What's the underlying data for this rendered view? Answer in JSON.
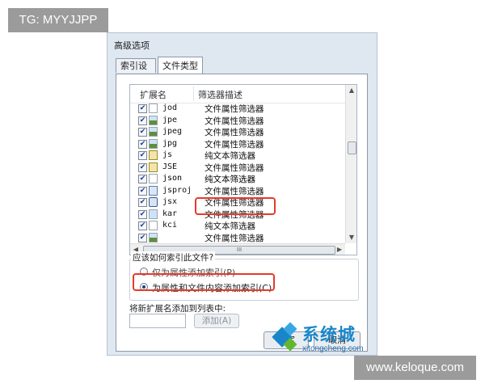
{
  "watermarks": {
    "top_left": "TG: MYYJJPP",
    "bottom_right": "www.keloque.com"
  },
  "dialog": {
    "title": "高级选项",
    "tabs": [
      {
        "label": "索引设置",
        "active": false
      },
      {
        "label": "文件类型",
        "active": true
      }
    ],
    "list": {
      "columns": [
        "扩展名",
        "筛选器描述"
      ],
      "rows": [
        {
          "ext": "jod",
          "filter": "文件属性筛选器",
          "checked": true,
          "icon": "blank-file-icon"
        },
        {
          "ext": "jpe",
          "filter": "文件属性筛选器",
          "checked": true,
          "icon": "image-file-icon"
        },
        {
          "ext": "jpeg",
          "filter": "文件属性筛选器",
          "checked": true,
          "icon": "image-file-icon"
        },
        {
          "ext": "jpg",
          "filter": "文件属性筛选器",
          "checked": true,
          "icon": "image-file-icon"
        },
        {
          "ext": "js",
          "filter": "纯文本筛选器",
          "checked": true,
          "icon": "script-file-icon"
        },
        {
          "ext": "JSE",
          "filter": "文件属性筛选器",
          "checked": true,
          "icon": "script-file-icon"
        },
        {
          "ext": "json",
          "filter": "纯文本筛选器",
          "checked": true,
          "icon": "blank-file-icon",
          "highlighted": true
        },
        {
          "ext": "jsproj",
          "filter": "文件属性筛选器",
          "checked": true,
          "icon": "project-file-icon"
        },
        {
          "ext": "jsx",
          "filter": "文件属性筛选器",
          "checked": true,
          "icon": "jsx-file-icon"
        },
        {
          "ext": "kar",
          "filter": "文件属性筛选器",
          "checked": true,
          "icon": "media-file-icon"
        },
        {
          "ext": "kci",
          "filter": "纯文本筛选器",
          "checked": true,
          "icon": "blank-file-icon"
        },
        {
          "ext": "",
          "filter": "文件属性筛选器",
          "checked": true,
          "icon": "image-file-icon"
        }
      ],
      "hscroll_grip": "III"
    },
    "index_group": {
      "label": "应该如何索引此文件?",
      "options": [
        {
          "label": "仅为属性添加索引(P)",
          "selected": false
        },
        {
          "label": "为属性和文件内容添加索引(C)",
          "selected": true
        }
      ]
    },
    "add": {
      "label": "将新扩展名添加到列表中:",
      "input_value": "",
      "button": "添加(A)"
    },
    "buttons": {
      "ok": "确定",
      "cancel": "取消"
    }
  },
  "logo": {
    "name": "系统城",
    "url": "xitongcheng.com"
  },
  "colors": {
    "highlight_box": "#e53a2a",
    "checkbox_mark": "#1d3f8a",
    "logo_blue": "#1a86c9"
  }
}
